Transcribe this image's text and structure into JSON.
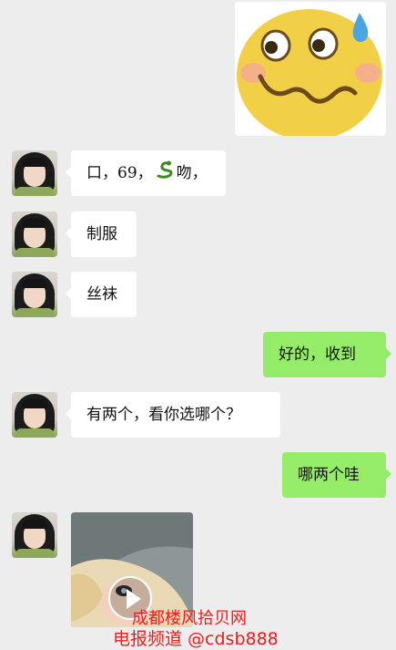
{
  "chat": {
    "sticker_icon": "sweating-emoji-sticker",
    "messages": [
      {
        "side": "left",
        "text_before": "口，69，",
        "emoji_icon": "snake-icon",
        "text_after": "吻，"
      },
      {
        "side": "left",
        "text": "制服"
      },
      {
        "side": "left",
        "text": "丝袜"
      },
      {
        "side": "right",
        "text": "好的，收到"
      },
      {
        "side": "left",
        "text": "有两个，看你选哪个？"
      },
      {
        "side": "right",
        "text": "哪两个哇"
      }
    ],
    "video_icon": "play-icon"
  },
  "watermark": {
    "line1": "成都楼风拾贝网",
    "line2": "电报频道 @cdsb888"
  },
  "colors": {
    "background": "#ededed",
    "incoming_bubble": "#ffffff",
    "outgoing_bubble": "#95ec69",
    "watermark": "#ee1c1c"
  }
}
